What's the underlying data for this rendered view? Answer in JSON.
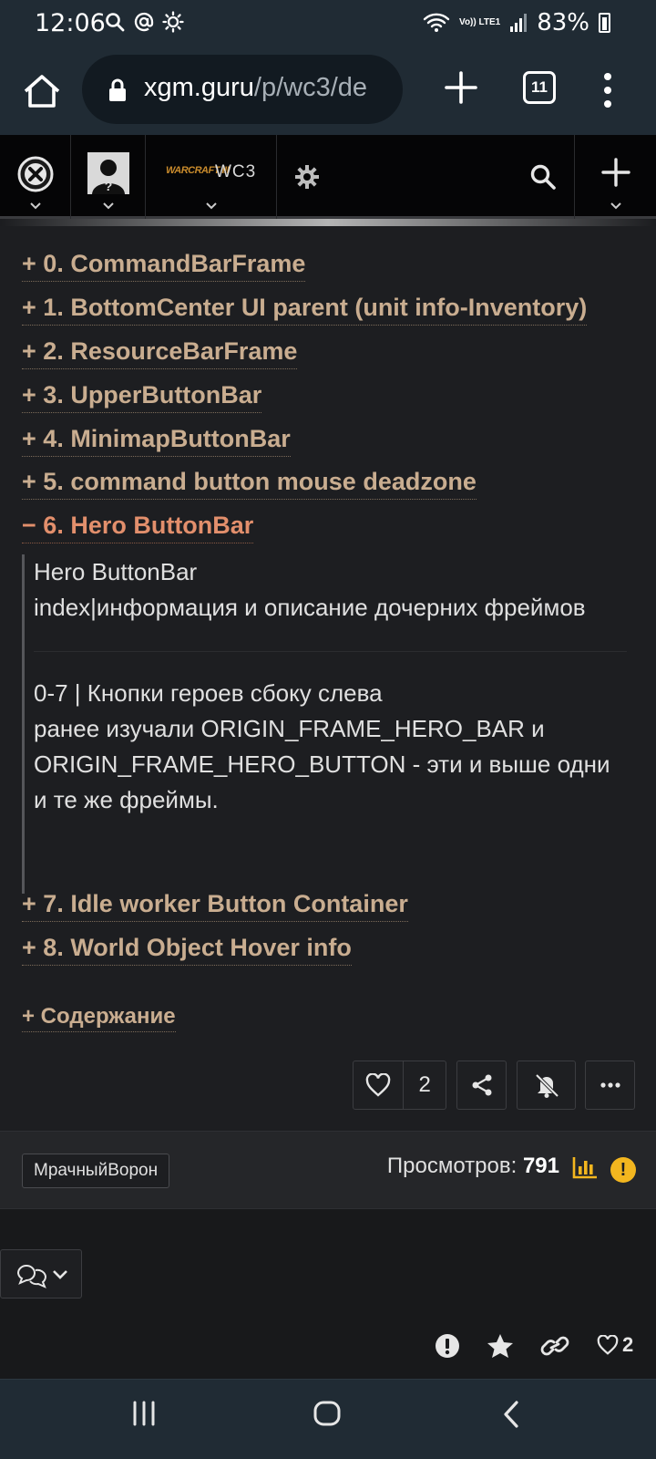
{
  "status_bar": {
    "time": "12:06",
    "left_icons": [
      "search-icon",
      "at-icon",
      "brightness-icon"
    ],
    "lte_label": "Vo)) LTE1",
    "battery": "83%"
  },
  "browser": {
    "url_domain": "xgm.guru",
    "url_path": "/p/wc3/de",
    "tab_count": "11"
  },
  "site_header": {
    "game_logo_text": "WARCRAFT III",
    "game_label": "WC3"
  },
  "spoilers": [
    {
      "prefix": "+",
      "label": "0. CommandBarFrame"
    },
    {
      "prefix": "+",
      "label": "1. BottomCenter UI parent (unit info-Inventory)"
    },
    {
      "prefix": "+",
      "label": "2. ResourceBarFrame"
    },
    {
      "prefix": "+",
      "label": "3. UpperButtonBar"
    },
    {
      "prefix": "+",
      "label": "4. MinimapButtonBar"
    },
    {
      "prefix": "+",
      "label": "5. command button mouse deadzone"
    },
    {
      "prefix": "−",
      "label": "6. Hero ButtonBar"
    },
    {
      "prefix": "+",
      "label": "7. Idle worker Button Container"
    },
    {
      "prefix": "+",
      "label": "8. World Object Hover info"
    }
  ],
  "open_spoiler": {
    "line1": "Hero ButtonBar",
    "line2": "index|информация и описание дочерних фреймов",
    "line3": "0-7 | Кнопки героев сбоку слева",
    "line4": "ранее изучали ORIGIN_FRAME_HERO_BAR и ORIGIN_FRAME_HERO_BUTTON - эти и выше одни и те же фреймы."
  },
  "toc_label": "+ Содержание",
  "actions": {
    "like_count": "2"
  },
  "info": {
    "author": "МрачныйВорон",
    "views_label": "Просмотров:",
    "views_count": "791",
    "alert_glyph": "!"
  },
  "bottom_bar": {
    "like_count": "2"
  },
  "colors": {
    "accent_link": "#c9ad90",
    "open_link": "#e28f6c",
    "warning": "#f3b61f",
    "stats": "#f3b61f"
  }
}
